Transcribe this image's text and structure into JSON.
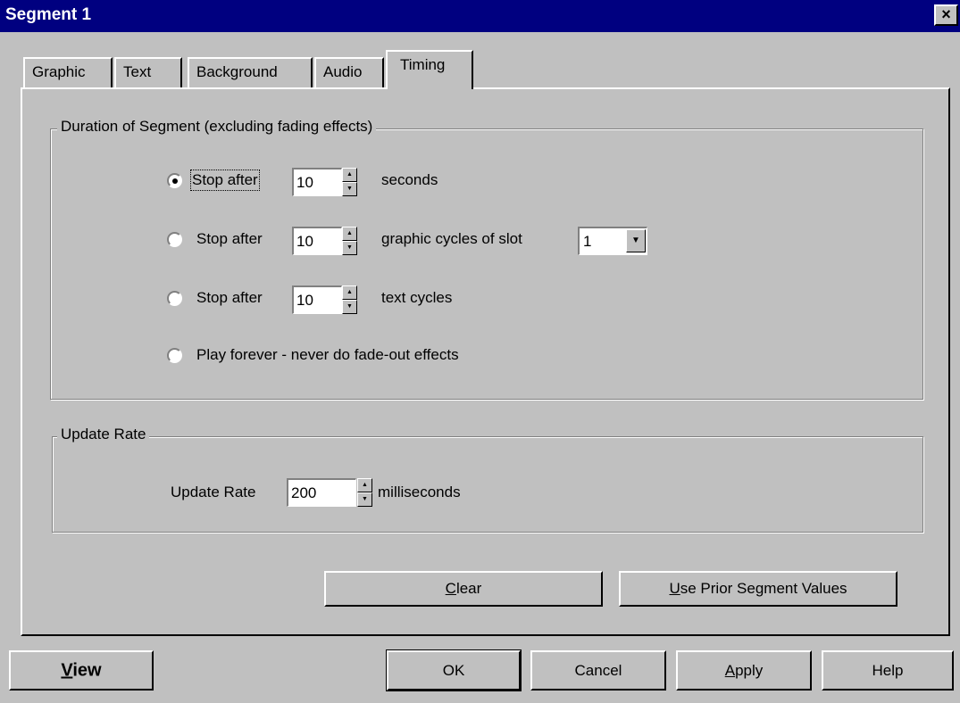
{
  "window": {
    "title": "Segment 1",
    "close_glyph": "×"
  },
  "tabs": [
    {
      "label": "Graphic"
    },
    {
      "label": "Text"
    },
    {
      "label": "Background"
    },
    {
      "label": "Audio"
    },
    {
      "label": "Timing",
      "active": true
    }
  ],
  "duration_group": {
    "legend": "Duration of Segment  (excluding fading effects)",
    "selected_option": 0,
    "options": [
      {
        "label": "Stop after",
        "value": "10",
        "suffix": "seconds"
      },
      {
        "label": "Stop after",
        "value": "10",
        "suffix": "graphic cycles of slot",
        "slot": "1"
      },
      {
        "label": "Stop after",
        "value": "10",
        "suffix": "text cycles"
      },
      {
        "label": "Play forever - never do fade-out effects"
      }
    ]
  },
  "update_group": {
    "legend": "Update Rate",
    "label": "Update Rate",
    "value": "200",
    "suffix": "milliseconds"
  },
  "panel_buttons": {
    "clear": {
      "mnemonic": "C",
      "rest": "lear"
    },
    "prior": {
      "mnemonic": "U",
      "rest": "se Prior Segment Values"
    }
  },
  "bottom_buttons": {
    "view": {
      "mnemonic": "V",
      "rest": "iew"
    },
    "ok": "OK",
    "cancel": "Cancel",
    "apply": {
      "mnemonic": "A",
      "rest": "pply"
    },
    "help": "Help"
  }
}
